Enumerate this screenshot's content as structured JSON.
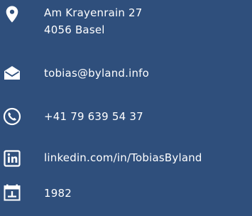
{
  "contact": {
    "address": {
      "icon": "location-pin-icon",
      "street": "Am Krayenrain 27",
      "city": "4056 Basel"
    },
    "email": {
      "icon": "envelope-icon",
      "value": "tobias@byland.info"
    },
    "phone": {
      "icon": "phone-icon",
      "value": "+41 79 639 54 37"
    },
    "linkedin": {
      "icon": "linkedin-icon",
      "value": "linkedin.com/in/TobiasByland"
    },
    "birth_year": {
      "icon": "calendar-icon",
      "value": "1982"
    }
  },
  "colors": {
    "background": "#2f4f7c",
    "foreground": "#ffffff"
  }
}
